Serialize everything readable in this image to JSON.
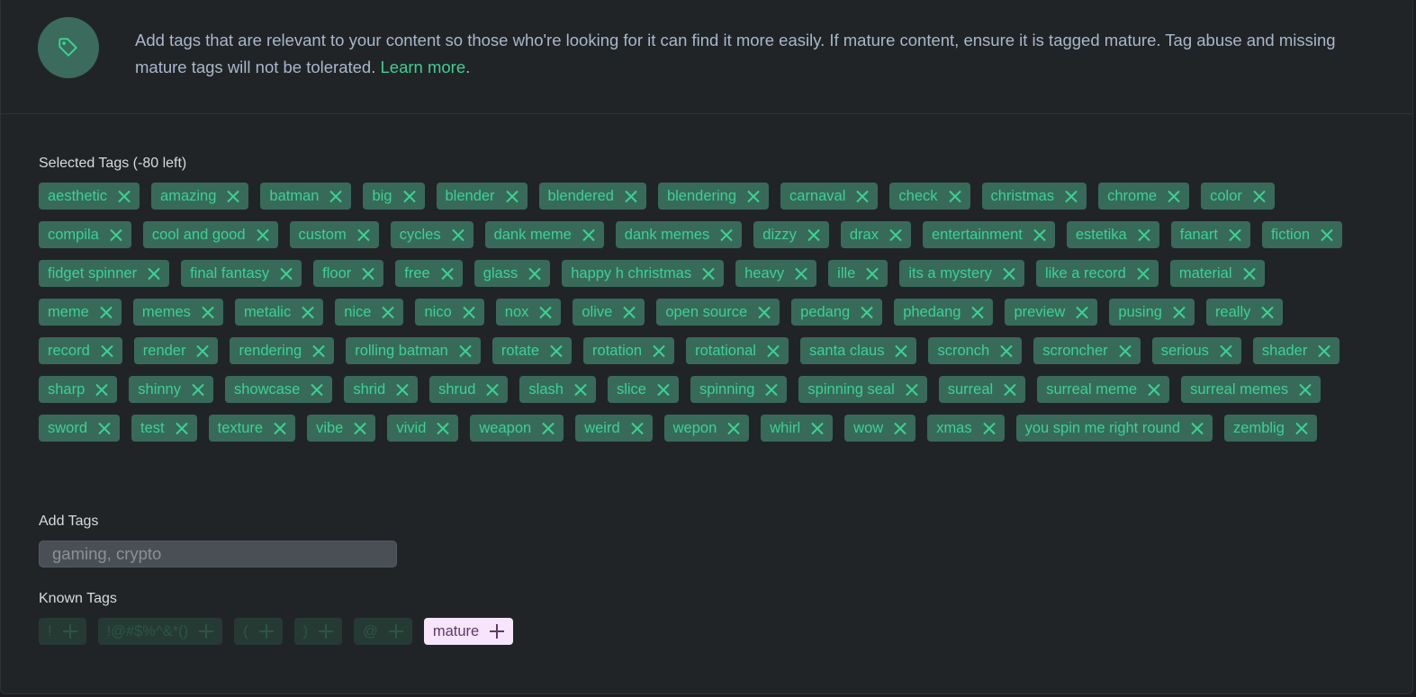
{
  "header": {
    "icon": "tag-icon",
    "notice": "Add tags that are relevant to your content so those who're looking for it can find it more easily. If mature content, ensure it is tagged mature. Tag abuse and missing mature tags will not be tolerated. ",
    "learn_more": "Learn more",
    "period": "."
  },
  "selected": {
    "label": "Selected Tags (-80 left)",
    "tags": [
      "aesthetic",
      "amazing",
      "batman",
      "big",
      "blender",
      "blendered",
      "blendering",
      "carnaval",
      "check",
      "christmas",
      "chrome",
      "color",
      "compila",
      "cool and good",
      "custom",
      "cycles",
      "dank meme",
      "dank memes",
      "dizzy",
      "drax",
      "entertainment",
      "estetika",
      "fanart",
      "fiction",
      "fidget spinner",
      "final fantasy",
      "floor",
      "free",
      "glass",
      "happy h christmas",
      "heavy",
      "ille",
      "its a mystery",
      "like a record",
      "material",
      "meme",
      "memes",
      "metalic",
      "nice",
      "nico",
      "nox",
      "olive",
      "open source",
      "pedang",
      "phedang",
      "preview",
      "pusing",
      "really",
      "record",
      "render",
      "rendering",
      "rolling batman",
      "rotate",
      "rotation",
      "rotational",
      "santa claus",
      "scronch",
      "scroncher",
      "serious",
      "shader",
      "sharp",
      "shinny",
      "showcase",
      "shrid",
      "shrud",
      "slash",
      "slice",
      "spinning",
      "spinning seal",
      "surreal",
      "surreal meme",
      "surreal memes",
      "sword",
      "test",
      "texture",
      "vibe",
      "vivid",
      "weapon",
      "weird",
      "wepon",
      "whirl",
      "wow",
      "xmas",
      "you spin me right round",
      "zemblig"
    ]
  },
  "add": {
    "label": "Add Tags",
    "placeholder": "gaming, crypto",
    "value": ""
  },
  "known": {
    "label": "Known Tags",
    "tags": [
      "!",
      "!@#$%^&*()",
      "(",
      ")",
      "@",
      "mature"
    ]
  },
  "colors": {
    "accent": "#3ecf94",
    "tag_bg": "#386a5a",
    "mature_bg": "#f6e5fb"
  }
}
